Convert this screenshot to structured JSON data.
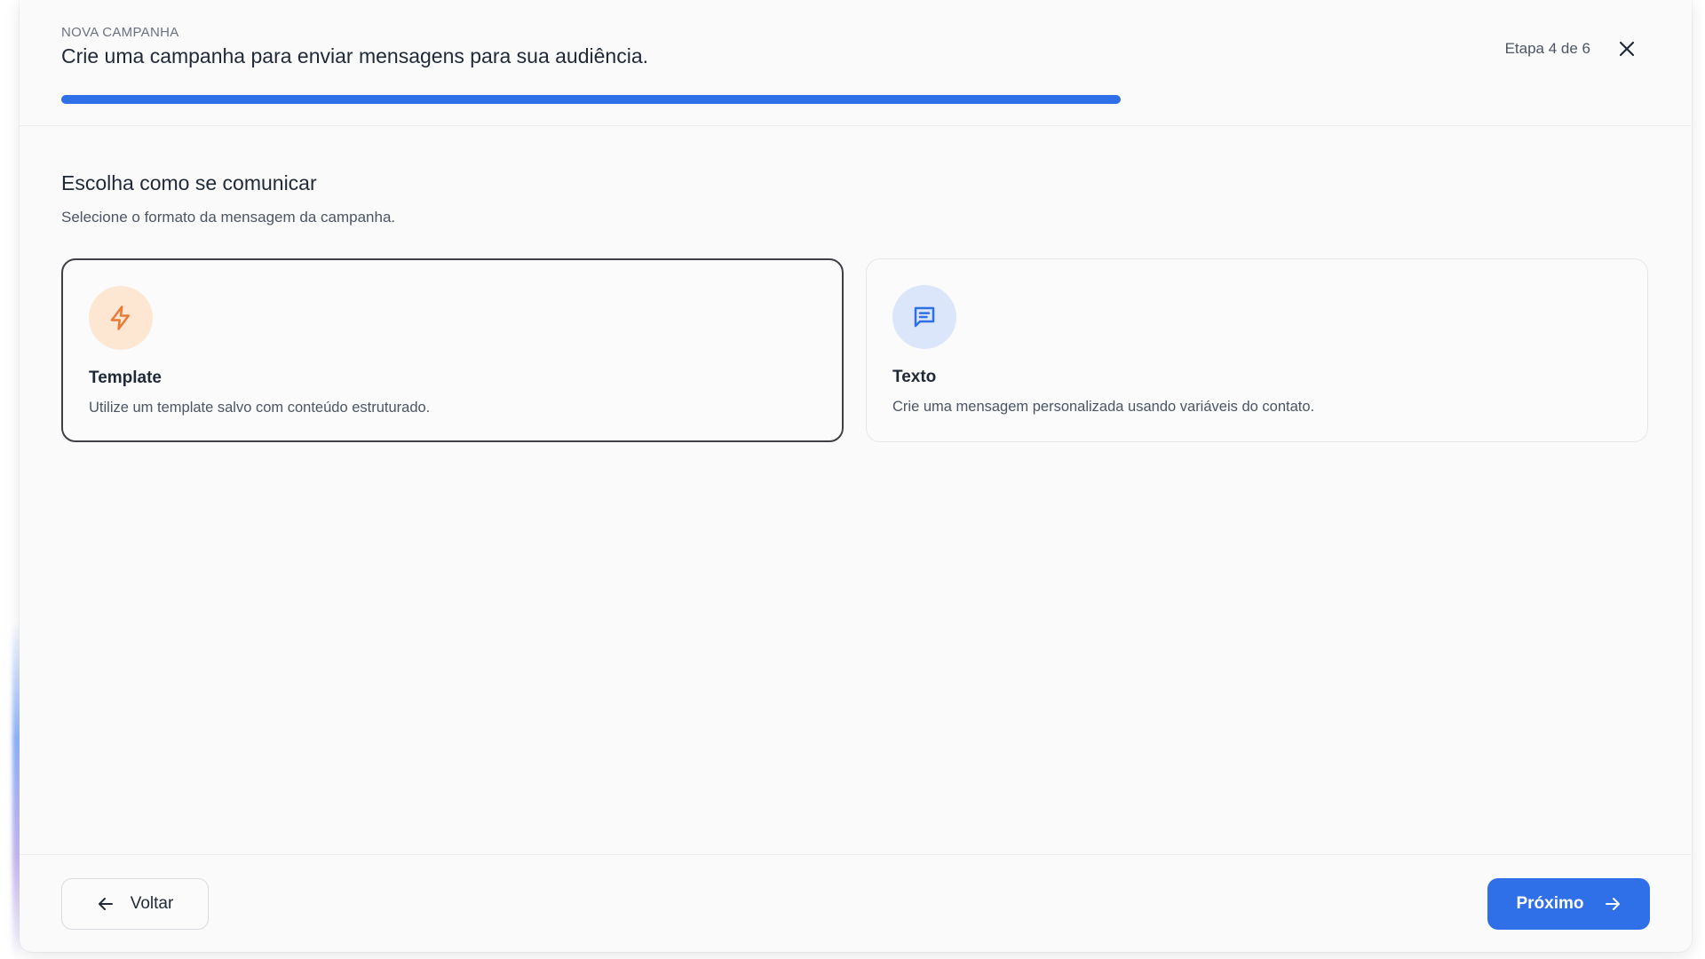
{
  "header": {
    "eyebrow": "NOVA CAMPANHA",
    "title": "Crie uma campanha para enviar mensagens para sua audiência.",
    "step": "Etapa 4 de 6",
    "progress": {
      "current": 4,
      "total": 6
    }
  },
  "section": {
    "title": "Escolha como se comunicar",
    "subtitle": "Selecione o formato da mensagem da campanha."
  },
  "options": [
    {
      "title": "Template",
      "description": "Utilize um template salvo com conteúdo estruturado.",
      "icon": "lightning-icon",
      "selected": true
    },
    {
      "title": "Texto",
      "description": "Crie uma mensagem personalizada usando variáveis do contato.",
      "icon": "message-square-icon",
      "selected": false
    }
  ],
  "footer": {
    "back_label": "Voltar",
    "next_label": "Próximo"
  },
  "colors": {
    "accent": "#2f6fe8",
    "template_icon": "#ea7a35",
    "template_icon_bg": "#fde7d3",
    "text_icon": "#2f6fe8",
    "text_icon_bg": "#dbe6fb"
  }
}
